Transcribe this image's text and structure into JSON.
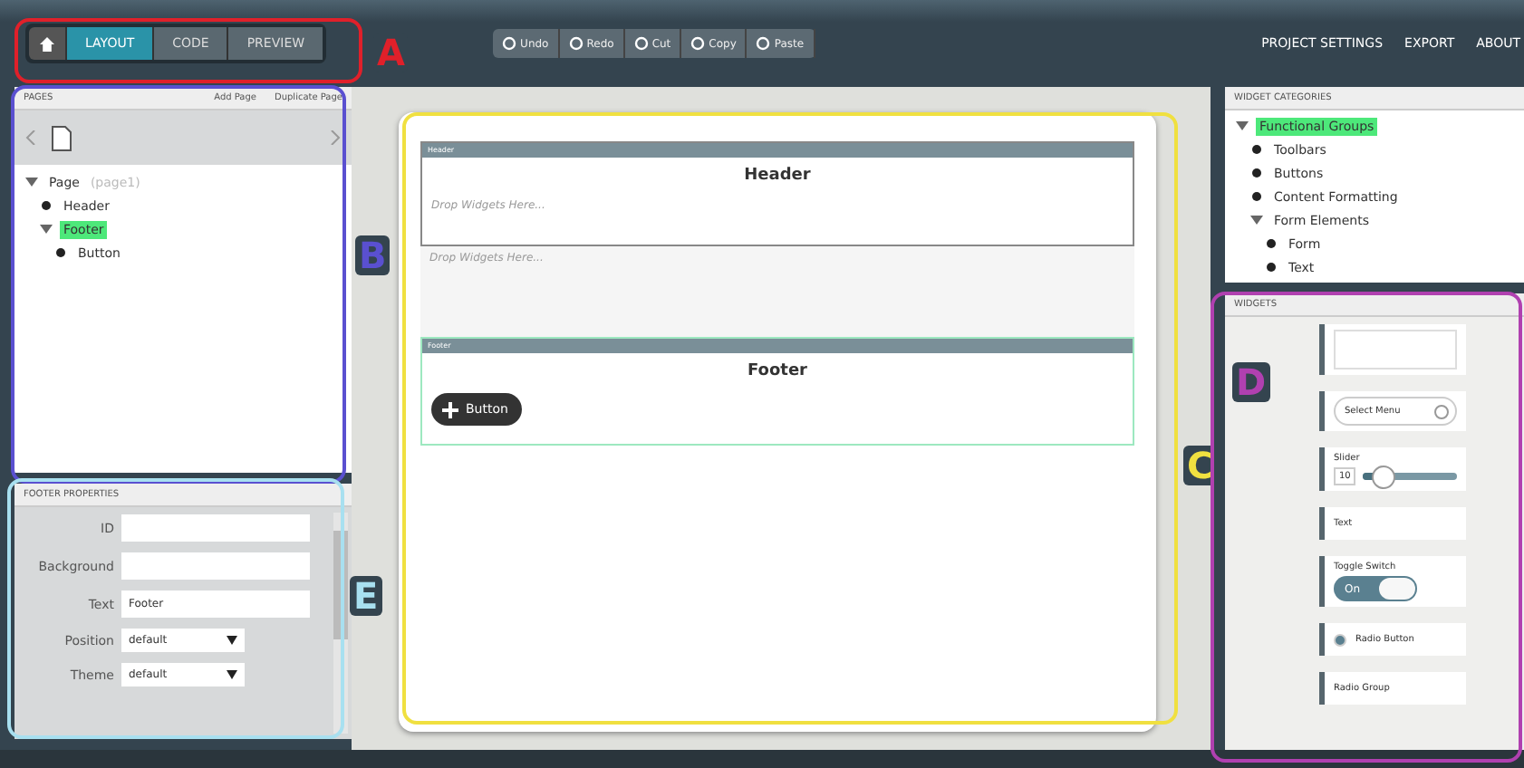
{
  "nav_tabs": [
    {
      "label": "LAYOUT",
      "selected": true
    },
    {
      "label": "CODE",
      "selected": false
    },
    {
      "label": "PREVIEW",
      "selected": false
    }
  ],
  "toolbar": [
    "Undo",
    "Redo",
    "Cut",
    "Copy",
    "Paste"
  ],
  "top_links": [
    "PROJECT SETTINGS",
    "EXPORT",
    "ABOUT"
  ],
  "pages_panel": {
    "title": "PAGES",
    "actions": [
      "Add Page",
      "Duplicate Page"
    ],
    "tree": [
      {
        "label": "Page",
        "note": "(page1)",
        "selected": false,
        "expanded": true,
        "children": [
          {
            "label": "Header",
            "selected": false
          },
          {
            "label": "Footer",
            "selected": true,
            "expanded": true,
            "children": [
              {
                "label": "Button",
                "selected": false
              }
            ]
          }
        ]
      }
    ]
  },
  "properties_panel": {
    "title": "FOOTER PROPERTIES",
    "fields": [
      {
        "kind": "input",
        "label": "ID"
      },
      {
        "kind": "input",
        "label": "Background"
      },
      {
        "kind": "input",
        "label": "Text",
        "value": "Footer"
      },
      {
        "kind": "select",
        "label": "Position",
        "value": "default"
      },
      {
        "kind": "select",
        "label": "Theme",
        "value": "default"
      }
    ]
  },
  "canvas": {
    "header": {
      "bar": "Header",
      "title": "Header",
      "drop_hint": "Drop Widgets Here..."
    },
    "content": {
      "drop_hint": "Drop Widgets Here..."
    },
    "footer": {
      "bar": "Footer",
      "title": "Footer",
      "button": "Button"
    }
  },
  "categories_panel": {
    "title": "WIDGET CATEGORIES",
    "tree": [
      {
        "label": "Functional Groups",
        "selected": true,
        "expanded": true,
        "children": [
          {
            "label": "Toolbars",
            "selected": false
          },
          {
            "label": "Buttons",
            "selected": false
          },
          {
            "label": "Content Formatting",
            "selected": false
          },
          {
            "label": "Form Elements",
            "selected": false,
            "expanded": true,
            "children": [
              {
                "label": "Form",
                "selected": false
              },
              {
                "label": "Text",
                "selected": false
              }
            ]
          }
        ]
      }
    ]
  },
  "widgets_panel": {
    "title": "WIDGETS",
    "widgets": [
      {
        "kind": "field"
      },
      {
        "kind": "select",
        "label": "Select Menu"
      },
      {
        "kind": "slider",
        "label": "Slider",
        "value": "10",
        "level": 0.2
      },
      {
        "kind": "text",
        "label": "Text"
      },
      {
        "kind": "toggle",
        "label": "Toggle Switch",
        "value": "On",
        "on": true
      },
      {
        "kind": "radio",
        "label": "Radio Button"
      },
      {
        "kind": "text",
        "label": "Radio Group"
      }
    ]
  },
  "annotations": [
    {
      "letter": "A",
      "color": "#e0202a"
    },
    {
      "letter": "B",
      "color": "#5a50d0"
    },
    {
      "letter": "C",
      "color": "#f0e040"
    },
    {
      "letter": "D",
      "color": "#b040b0"
    },
    {
      "letter": "E",
      "color": "#a8e0f0"
    }
  ]
}
